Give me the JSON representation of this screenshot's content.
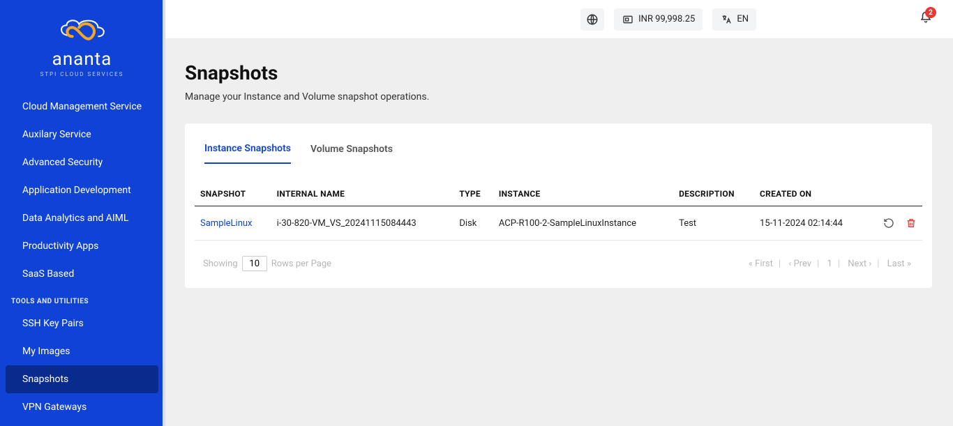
{
  "brand": {
    "name": "ananta",
    "tagline": "STPI CLOUD SERVICES"
  },
  "sidebar": {
    "items": [
      {
        "label": "Cloud Management Service"
      },
      {
        "label": "Auxilary Service"
      },
      {
        "label": "Advanced Security"
      },
      {
        "label": "Application Development"
      },
      {
        "label": "Data Analytics and AIML"
      },
      {
        "label": "Productivity Apps"
      },
      {
        "label": "SaaS Based"
      }
    ],
    "tools_label": "TOOLS AND UTILITIES",
    "tools": [
      {
        "label": "SSH Key Pairs"
      },
      {
        "label": "My Images"
      },
      {
        "label": "Snapshots",
        "active": true
      },
      {
        "label": "VPN Gateways"
      }
    ]
  },
  "topbar": {
    "balance": "INR 99,998.25",
    "lang": "EN",
    "notif_count": "2"
  },
  "page": {
    "title": "Snapshots",
    "desc": "Manage your Instance and Volume snapshot operations."
  },
  "tabs": [
    {
      "label": "Instance Snapshots",
      "active": true
    },
    {
      "label": "Volume Snapshots"
    }
  ],
  "table": {
    "headers": [
      "SNAPSHOT",
      "INTERNAL NAME",
      "TYPE",
      "INSTANCE",
      "DESCRIPTION",
      "CREATED ON"
    ],
    "rows": [
      {
        "snapshot": "SampleLinux",
        "internal": "i-30-820-VM_VS_20241115084443",
        "type": "Disk",
        "instance": "ACP-R100-2-SampleLinuxInstance",
        "description": "Test",
        "created": "15-11-2024 02:14:44"
      }
    ]
  },
  "pager": {
    "showing": "Showing",
    "rows_value": "10",
    "rows_per_page": "Rows per Page",
    "first": "« First",
    "prev": "‹ Prev",
    "page": "1",
    "next": "Next ›",
    "last": "Last »"
  }
}
